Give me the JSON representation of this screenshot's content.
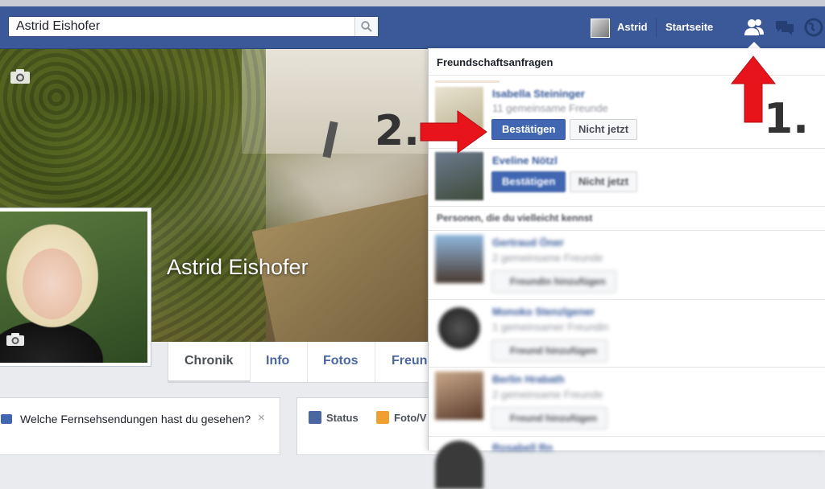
{
  "topbar": {
    "search_value": "Astrid Eishofer",
    "user_name": "Astrid",
    "home_label": "Startseite"
  },
  "profile": {
    "name": "Astrid Eishofer",
    "tabs": [
      "Chronik",
      "Info",
      "Fotos",
      "Freun"
    ]
  },
  "feed": {
    "prompt_text": "Welche Fernsehsendungen hast du gesehen?",
    "prompt_close": "×",
    "composer_status": "Status",
    "composer_photo": "Foto/V"
  },
  "friend_requests": {
    "header": "Freundschaftsanfragen",
    "requests": [
      {
        "name": "Isabella Steininger",
        "mutual": "11 gemeinsame Freunde",
        "confirm": "Bestätigen",
        "later": "Nicht jetzt"
      },
      {
        "name": "Eveline Nötzl",
        "confirm": "Bestätigen",
        "later": "Nicht jetzt"
      }
    ],
    "suggestions_header": "Personen, die du vielleicht kennst",
    "suggestions": [
      {
        "name": "Gertraud Öner",
        "mutual": "2 gemeinsame Freunde",
        "action": "Freundin hinzufügen"
      },
      {
        "name": "Monoko Stenzlgener",
        "mutual": "1 gemeinsamer Freundin",
        "action": "Freund hinzufügen"
      },
      {
        "name": "Berlin Hrabath",
        "mutual": "2 gemeinsame Freunde",
        "action": "Freund hinzufügen"
      },
      {
        "name": "Rosabell Rn"
      }
    ]
  },
  "annotations": {
    "step1": "1.",
    "step2": "2.",
    "arrow_color": "#e8141b"
  },
  "colors": {
    "brand_blue": "#3b5998",
    "button_blue": "#4267b2",
    "link_blue": "#365899"
  }
}
